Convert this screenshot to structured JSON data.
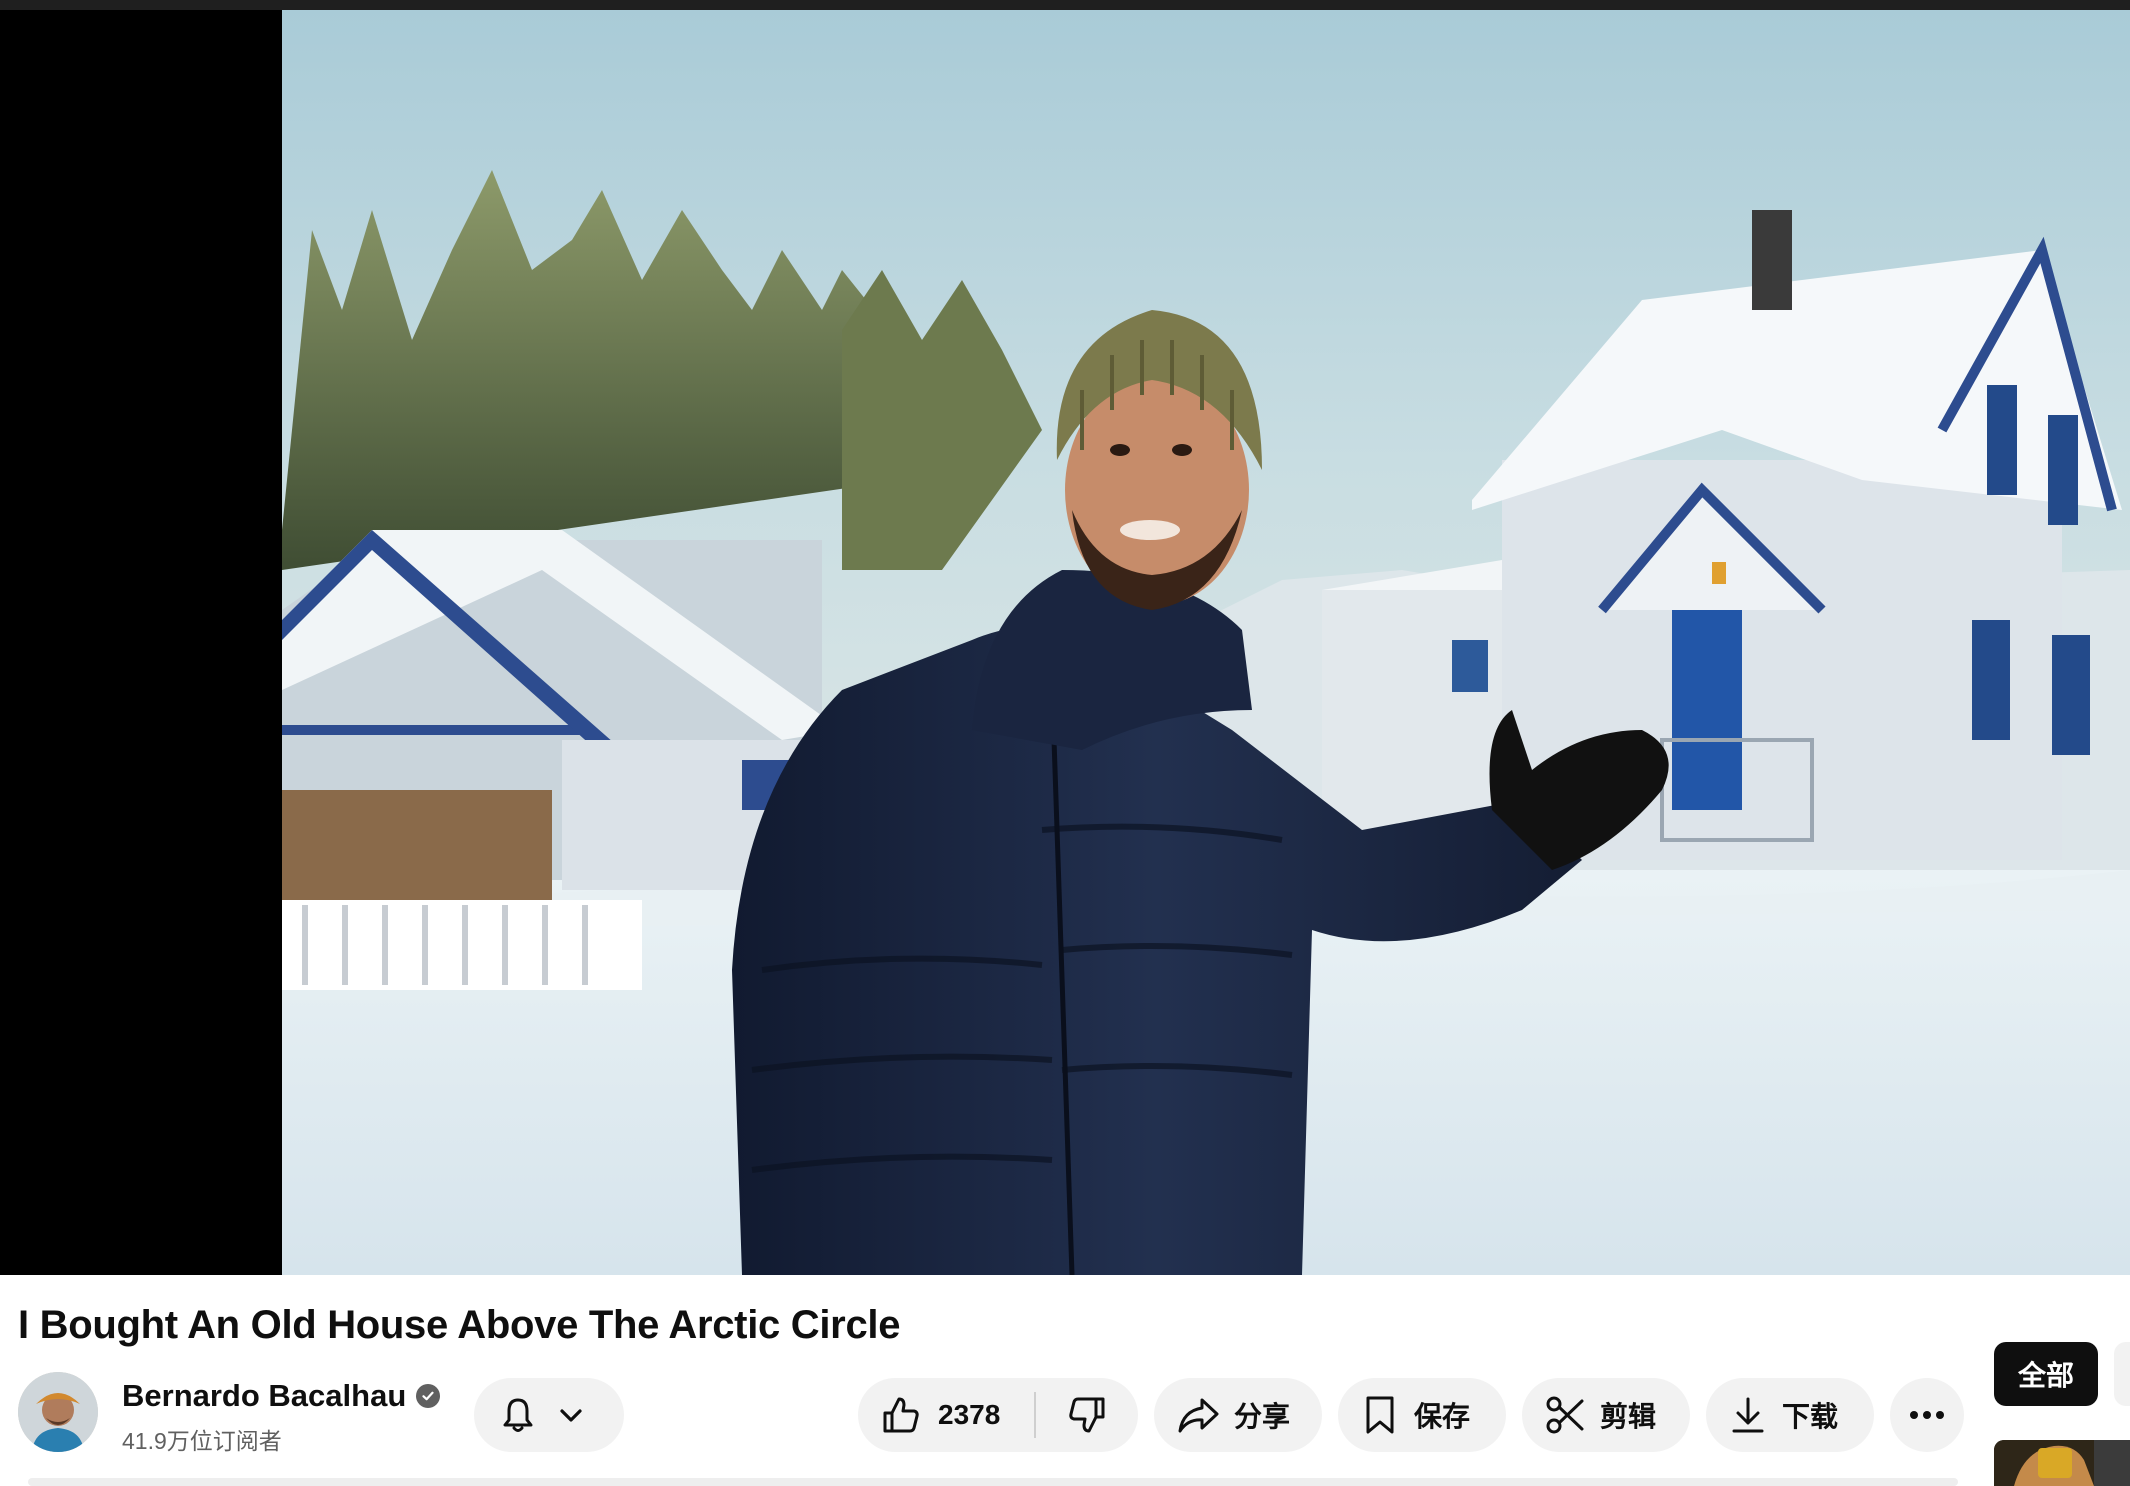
{
  "video": {
    "title": "I Bought An Old House Above The Arctic Circle"
  },
  "channel": {
    "name": "Bernardo Bacalhau",
    "verified": true,
    "subscribers": "41.9万位订阅者"
  },
  "actions": {
    "like_count": "2378",
    "share_label": "分享",
    "save_label": "保存",
    "clip_label": "剪辑",
    "download_label": "下载"
  },
  "side_panel": {
    "chip_all_label": "全部"
  },
  "icons": {
    "notification": "bell-icon",
    "dropdown": "chevron-down-icon",
    "like": "thumb-up-icon",
    "dislike": "thumb-down-icon",
    "share": "share-arrow-icon",
    "save": "bookmark-icon",
    "clip": "scissors-icon",
    "download": "download-icon",
    "more": "more-horizontal-icon",
    "verified": "check-badge-icon"
  },
  "colors": {
    "pill_bg": "#f2f2f2",
    "chip_active_bg": "#0f0f0f",
    "secondary_text": "#606060"
  }
}
